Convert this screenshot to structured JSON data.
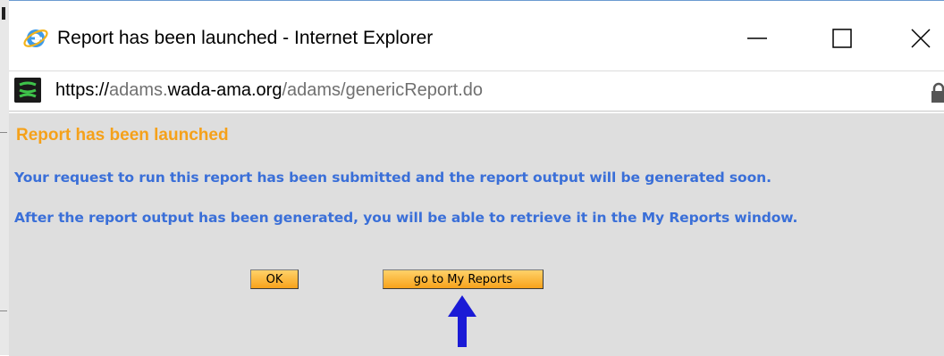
{
  "window": {
    "title": "Report has been launched - Internet Explorer",
    "app_icon": "internet-explorer-icon",
    "controls": {
      "minimize_glyph": "—",
      "maximize_glyph": "☐",
      "close_glyph": "✕"
    }
  },
  "address_bar": {
    "site_icon": "wada-site-icon",
    "url_scheme": "https://",
    "url_subdomain": "adams.",
    "url_domain": "wada-ama.org",
    "url_path": "/adams/genericReport.do",
    "lock_icon": "lock-icon"
  },
  "dialog": {
    "heading": "Report has been launched",
    "message_1": "Your request to run this report has been submitted and the report output will be generated soon.",
    "message_2": "After the report output has been generated, you will be able to retrieve it in the My Reports window.",
    "ok_label": "OK",
    "go_reports_label": "go to My Reports"
  },
  "colors": {
    "heading": "#f5a11a",
    "message": "#3a6fd8",
    "button": "#f7a21b",
    "content_bg": "#dedede",
    "annotation_arrow": "#1a1ad6"
  }
}
